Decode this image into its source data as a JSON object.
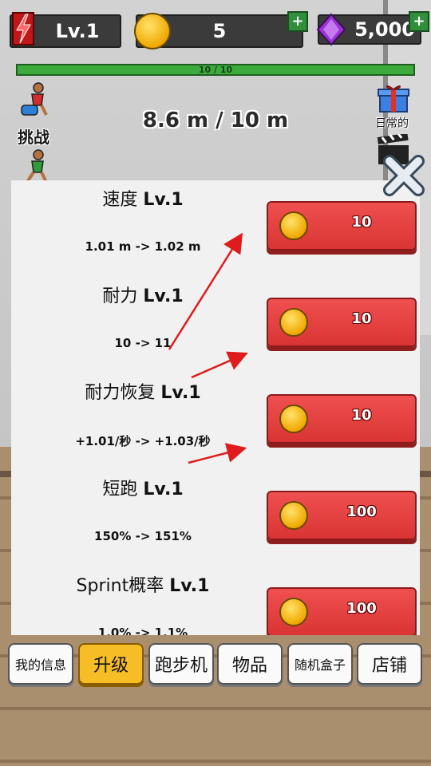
{
  "hud": {
    "level": "Lv.1",
    "coins": "5",
    "gems": "5,000",
    "plus": "+",
    "stamina": "10 / 10",
    "stamina_fraction": 1.0
  },
  "scene": {
    "challenge_label": "挑战",
    "distance": "8.6 m / 10 m",
    "daily_label": "日常的"
  },
  "upgrades": [
    {
      "name": "速度",
      "level": "Lv.1",
      "detail": "1.01 m -> 1.02 m",
      "price": "10"
    },
    {
      "name": "耐力",
      "level": "Lv.1",
      "detail": "10 -> 11",
      "price": "10"
    },
    {
      "name": "耐力恢复",
      "level": "Lv.1",
      "detail": "+1.01/秒 -> +1.03/秒",
      "price": "10"
    },
    {
      "name": "短跑",
      "level": "Lv.1",
      "detail": "150% -> 151%",
      "price": "100"
    },
    {
      "name": "Sprint概率",
      "level": "Lv.1",
      "detail": "1.0% -> 1.1%",
      "price": "100"
    }
  ],
  "tabs": [
    {
      "label": "我的信息",
      "active": false
    },
    {
      "label": "升级",
      "active": true
    },
    {
      "label": "跑步机",
      "active": false
    },
    {
      "label": "物品",
      "active": false
    },
    {
      "label": "随机盒子",
      "active": false
    },
    {
      "label": "店铺",
      "active": false
    }
  ],
  "colors": {
    "accent_active_tab": "#f6bd26",
    "buy_button": "#e24343",
    "stamina_bar": "#3cab3c",
    "annotation_arrow": "#e01b1b"
  },
  "icons": [
    "lightning-icon",
    "coin-icon",
    "gem-icon",
    "runner-icon",
    "gift-icon",
    "clapperboard-icon",
    "close-icon"
  ]
}
